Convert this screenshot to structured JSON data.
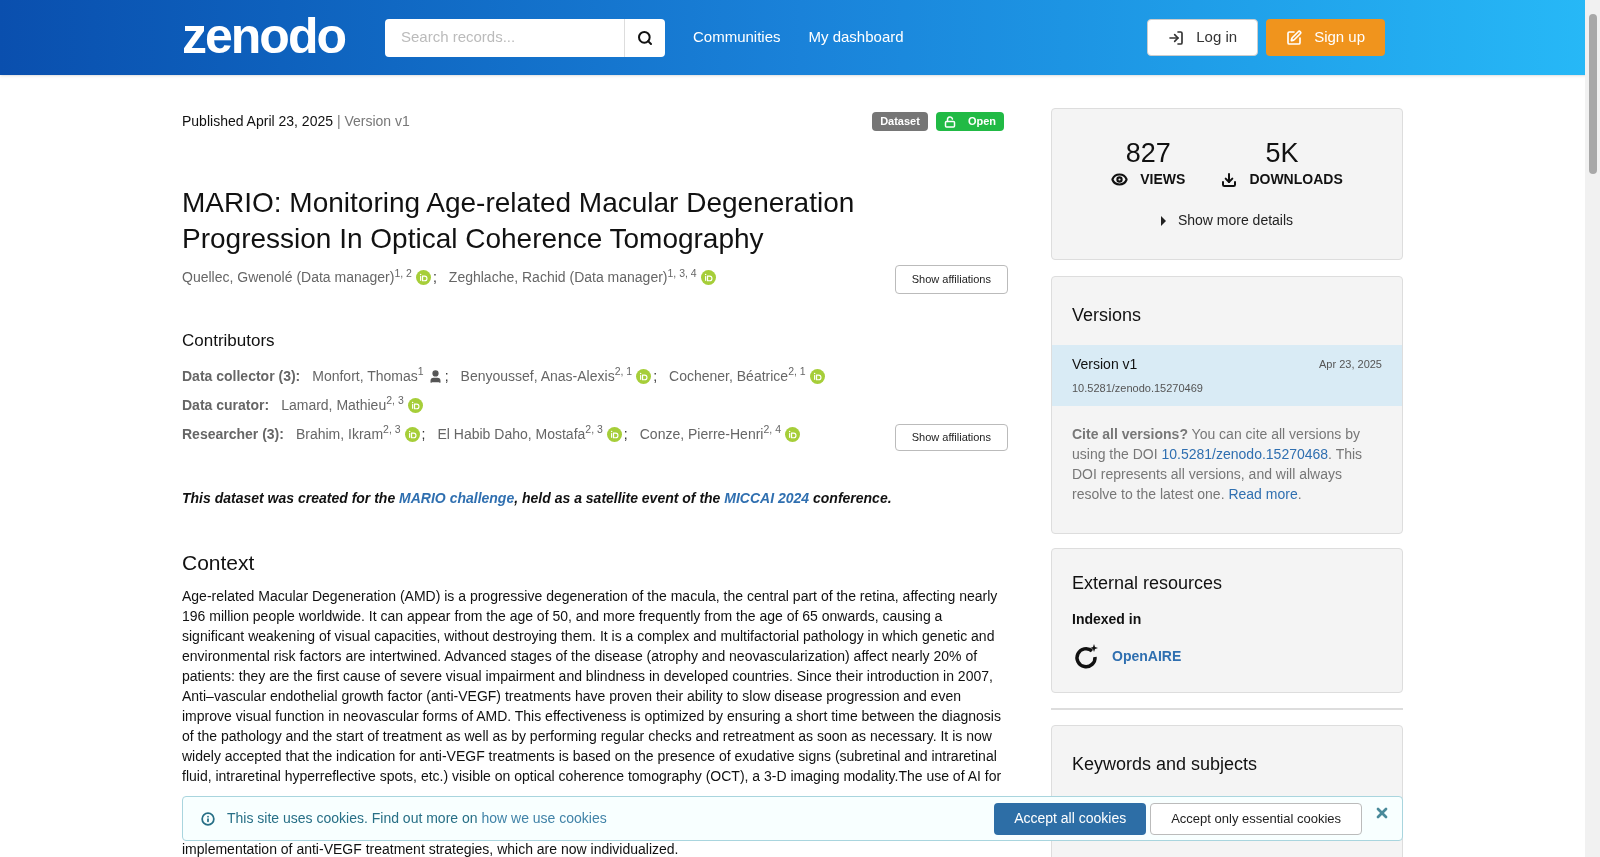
{
  "header": {
    "logo": "zenodo",
    "search": {
      "placeholder": "Search records..."
    },
    "nav": [
      "Communities",
      "My dashboard"
    ],
    "login": "Log in",
    "signup": "Sign up"
  },
  "record": {
    "published": "Published April 23, 2025",
    "version": "| Version v1",
    "badges": [
      {
        "label": "Dataset",
        "color": "#767676",
        "kind": "type"
      },
      {
        "label": "Open",
        "color": "#21ba45",
        "kind": "access"
      }
    ],
    "title": "MARIO: Monitoring Age-related Macular Degeneration Progression In Optical Coherence Tomography",
    "creators": [
      {
        "name": "Quellec, Gwenolé (Data manager)$^{1, 2}$",
        "kind": "orcid",
        "separator": ";"
      },
      {
        "name": "Zeghlache, Rachid (Data manager)$^{1, 3, 4}$",
        "kind": "orcid"
      }
    ],
    "show_affiliations": "Show affiliations",
    "contributors_heading": "Contributors",
    "contributor_groups": [
      {
        "role": "Data collector (3):",
        "people": [
          {
            "name": "Monfort, Thomas$^{1}$",
            "kind": "person",
            "separator": ";"
          },
          {
            "name": "Benyoussef, Anas-Alexis$^{2, 1}$",
            "kind": "orcid",
            "separator": ";"
          },
          {
            "name": "Cochener, Béatrice$^{2, 1}$",
            "kind": "orcid"
          }
        ]
      },
      {
        "role": "Data curator:",
        "people": [
          {
            "name": "Lamard, Mathieu$^{2, 3}$",
            "kind": "orcid"
          }
        ]
      },
      {
        "role": "Researcher (3):",
        "people": [
          {
            "name": "Brahim, Ikram$^{2, 3}$",
            "kind": "orcid",
            "separator": ";"
          },
          {
            "name": "El Habib Daho, Mostafa$^{2, 3}$",
            "kind": "orcid",
            "separator": ";"
          },
          {
            "name": "Conze, Pierre-Henri$^{2, 4}$",
            "kind": "orcid"
          }
        ]
      }
    ],
    "contributors_show_affiliations": "Show affiliations",
    "note": [
      {
        "kind": "text",
        "text": "This dataset was created for the "
      },
      {
        "kind": "link",
        "text": "MARIO challenge"
      },
      {
        "kind": "text",
        "text": ", held as a satellite event of the "
      },
      {
        "kind": "link",
        "text": "MICCAI 2024"
      },
      {
        "kind": "text",
        "text": " conference."
      }
    ],
    "context_heading": "Context",
    "context_paragraph": "Age-related Macular Degeneration (AMD) is a progressive degeneration of the macula, the central part of the retina, affecting nearly 196 million people worldwide. It can appear from the age of 50, and more frequently from the age of 65 onwards, causing a significant weakening of visual capacities, without destroying them. It is a complex and multifactorial pathology in which genetic and environmental risk factors are intertwined. Advanced stages of the disease (atrophy and neovascularization) affect nearly 20% of patients: they are the first cause of severe visual impairment and blindness in developed countries. Since their introduction in 2007, Anti–vascular endothelial growth factor (anti-VEGF) treatments have proven their ability to slow disease progression and even improve visual function in neovascular forms of AMD. This effectiveness is optimized by ensuring a short time between the diagnosis of the pathology and the start of treatment as well as by performing regular checks and retreatment as soon as necessary. It is now widely accepted that the indication for anti-VEGF treatments is based on the presence of exudative signs (subretinal and intraretinal fluid, intraretinal hyperreflective spots, etc.) visible on optical coherence tomography (OCT), a 3-D imaging modality.The use of AI for",
    "context_tail": "implementation of anti-VEGF treatment strategies, which are now individualized."
  },
  "sidebar": {
    "stats": [
      {
        "value": "827",
        "label": "VIEWS",
        "kind": "views"
      },
      {
        "value": "5K",
        "label": "DOWNLOADS",
        "kind": "downloads"
      }
    ],
    "more_details": "Show more details",
    "versions": {
      "heading": "Versions",
      "items": [
        {
          "label": "Version v1",
          "date": "Apr 23, 2025",
          "doi": "10.5281/zenodo.15270469",
          "selected": true
        }
      ],
      "cite": [
        {
          "kind": "bold",
          "text": "Cite all versions?"
        },
        {
          "kind": "text",
          "text": " You can cite all versions by using the DOI "
        },
        {
          "kind": "link",
          "text": "10.5281/zenodo.15270468"
        },
        {
          "kind": "text",
          "text": ". This DOI represents all versions, and will always resolve to the latest one. "
        },
        {
          "kind": "link",
          "text": "Read more"
        },
        {
          "kind": "text",
          "text": "."
        }
      ]
    },
    "external": {
      "heading": "External resources",
      "subheading": "Indexed in",
      "link": "OpenAIRE"
    },
    "keywords": {
      "heading": "Keywords and subjects"
    }
  },
  "cookies": {
    "message": "This site uses cookies. Find out more on ",
    "link": "how we use cookies",
    "accept_all": "Accept all cookies",
    "accept_essential": "Accept only essential cookies"
  }
}
